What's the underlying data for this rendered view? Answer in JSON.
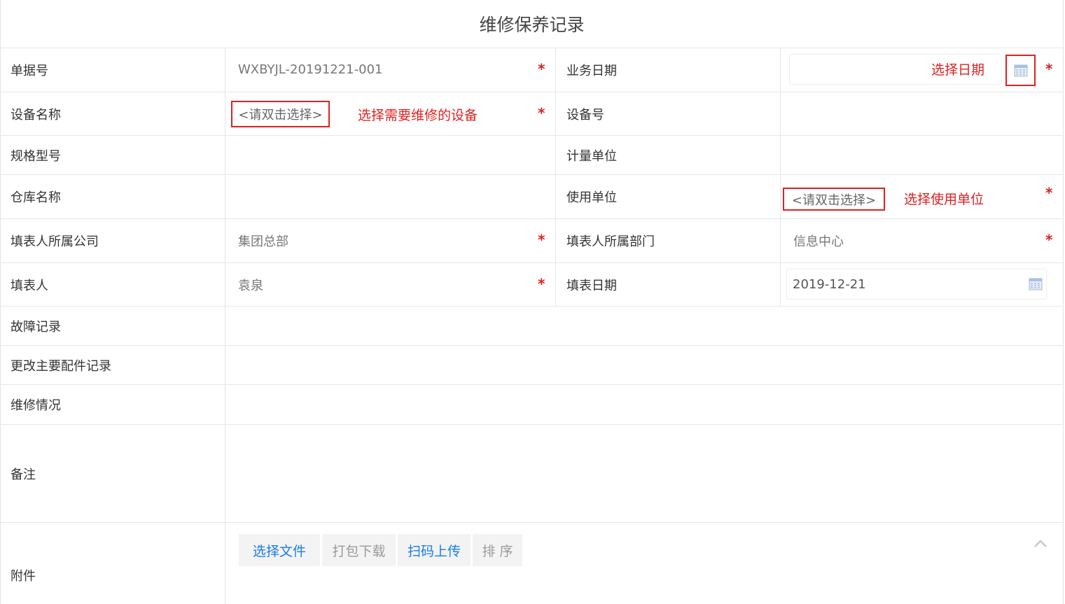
{
  "page": {
    "title": "维修保养记录"
  },
  "form": {
    "doc_no": {
      "label": "单据号",
      "value": "WXBYJL-20191221-001",
      "required": "*"
    },
    "biz_date": {
      "label": "业务日期",
      "value": "",
      "required": "*",
      "annotation": "选择日期"
    },
    "device_name": {
      "label": "设备名称",
      "placeholder": "<请双击选择>",
      "required": "*",
      "annotation": "选择需要维修的设备"
    },
    "device_no": {
      "label": "设备号",
      "value": ""
    },
    "spec_model": {
      "label": "规格型号",
      "value": ""
    },
    "unit": {
      "label": "计量单位",
      "value": ""
    },
    "warehouse": {
      "label": "仓库名称",
      "value": ""
    },
    "use_dept": {
      "label": "使用单位",
      "placeholder": "<请双击选择>",
      "required": "*",
      "annotation": "选择使用单位"
    },
    "company": {
      "label": "填表人所属公司",
      "value": "集团总部",
      "required": "*"
    },
    "department": {
      "label": "填表人所属部门",
      "value": "信息中心",
      "required": "*"
    },
    "filler": {
      "label": "填表人",
      "value": "袁泉",
      "required": "*"
    },
    "fill_date": {
      "label": "填表日期",
      "value": "2019-12-21"
    },
    "fault_record": {
      "label": "故障记录",
      "value": ""
    },
    "parts_record": {
      "label": "更改主要配件记录",
      "value": ""
    },
    "repair_status": {
      "label": "维修情况",
      "value": ""
    },
    "remarks": {
      "label": "备注",
      "value": ""
    },
    "attachment": {
      "label": "附件"
    }
  },
  "attachment_buttons": {
    "select_file": "选择文件",
    "pack_download": "打包下载",
    "scan_upload": "扫码上传",
    "sort": "排 序"
  },
  "icons": {
    "calendar": "calendar-icon",
    "collapse": "chevron-up-icon"
  },
  "colors": {
    "required": "#e02020",
    "link": "#1a7de0",
    "border": "#e6e6e6"
  }
}
